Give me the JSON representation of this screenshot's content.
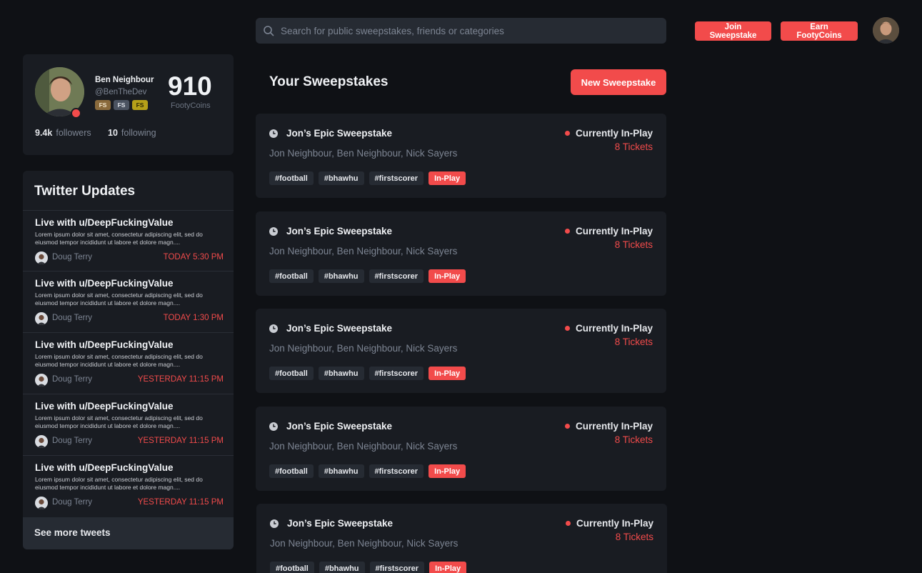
{
  "search": {
    "placeholder": "Search for public sweepstakes, friends or categories"
  },
  "header": {
    "join_label": "Join Sweepstake",
    "earn_label": "Earn FootyCoins"
  },
  "profile": {
    "name": "Ben Neighbour",
    "handle": "@BenTheDev",
    "badges": [
      "FS",
      "FS",
      "FS"
    ],
    "coins": "910",
    "coins_label": "FootyCoins",
    "followers_count": "9.4k",
    "followers_label": "followers",
    "following_count": "10",
    "following_label": "following"
  },
  "twitter": {
    "title": "Twitter Updates",
    "see_more": "See more tweets",
    "tweets": [
      {
        "title": "Live with u/DeepFuckingValue",
        "body": "Lorem ipsum dolor sit amet, consectetur adipiscing elit, sed do eiusmod tempor incididunt ut labore et dolore magn....",
        "author": "Doug Terry",
        "time": "TODAY 5:30 PM"
      },
      {
        "title": "Live with u/DeepFuckingValue",
        "body": "Lorem ipsum dolor sit amet, consectetur adipiscing elit, sed do eiusmod tempor incididunt ut labore et dolore magn....",
        "author": "Doug Terry",
        "time": "TODAY 1:30 PM"
      },
      {
        "title": "Live with u/DeepFuckingValue",
        "body": "Lorem ipsum dolor sit amet, consectetur adipiscing elit, sed do eiusmod tempor incididunt ut labore et dolore magn....",
        "author": "Doug Terry",
        "time": "YESTERDAY 11:15 PM"
      },
      {
        "title": "Live with u/DeepFuckingValue",
        "body": "Lorem ipsum dolor sit amet, consectetur adipiscing elit, sed do eiusmod tempor incididunt ut labore et dolore magn....",
        "author": "Doug Terry",
        "time": "YESTERDAY 11:15 PM"
      },
      {
        "title": "Live with u/DeepFuckingValue",
        "body": "Lorem ipsum dolor sit amet, consectetur adipiscing elit, sed do eiusmod tempor incididunt ut labore et dolore magn....",
        "author": "Doug Terry",
        "time": "YESTERDAY 11:15 PM"
      }
    ]
  },
  "main": {
    "title": "Your Sweepstakes",
    "new_label": "New Sweepstake",
    "sweepstakes": [
      {
        "name": "Jon’s Epic Sweepstake",
        "members": "Jon Neighbour, Ben Neighbour, Nick Sayers",
        "status": "Currently In-Play",
        "tickets": "8 Tickets",
        "tags": [
          "#football",
          "#bhawhu",
          "#firstscorer"
        ],
        "live_tag": "In-Play"
      },
      {
        "name": "Jon’s Epic Sweepstake",
        "members": "Jon Neighbour, Ben Neighbour, Nick Sayers",
        "status": "Currently In-Play",
        "tickets": "8 Tickets",
        "tags": [
          "#football",
          "#bhawhu",
          "#firstscorer"
        ],
        "live_tag": "In-Play"
      },
      {
        "name": "Jon’s Epic Sweepstake",
        "members": "Jon Neighbour, Ben Neighbour, Nick Sayers",
        "status": "Currently In-Play",
        "tickets": "8 Tickets",
        "tags": [
          "#football",
          "#bhawhu",
          "#firstscorer"
        ],
        "live_tag": "In-Play"
      },
      {
        "name": "Jon’s Epic Sweepstake",
        "members": "Jon Neighbour, Ben Neighbour, Nick Sayers",
        "status": "Currently In-Play",
        "tickets": "8 Tickets",
        "tags": [
          "#football",
          "#bhawhu",
          "#firstscorer"
        ],
        "live_tag": "In-Play"
      },
      {
        "name": "Jon’s Epic Sweepstake",
        "members": "Jon Neighbour, Ben Neighbour, Nick Sayers",
        "status": "Currently In-Play",
        "tickets": "8 Tickets",
        "tags": [
          "#football",
          "#bhawhu",
          "#firstscorer"
        ],
        "live_tag": "In-Play"
      }
    ]
  },
  "colors": {
    "accent": "#f24b4b",
    "background": "#0f1115",
    "card": "#191c22",
    "chip": "#262b33"
  },
  "icons": {
    "search": "search-icon",
    "clock": "clock-icon",
    "status": "live-dot-icon"
  }
}
